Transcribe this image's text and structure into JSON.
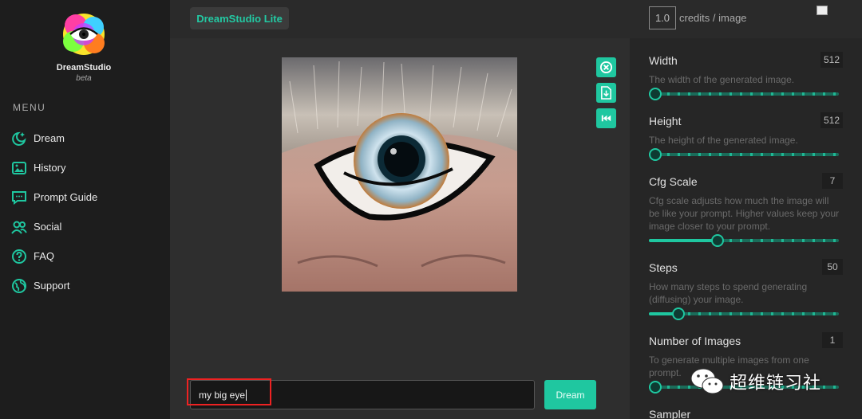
{
  "topbar": {
    "brand_label": "DreamStudio Lite",
    "credits_value": "1.0",
    "credits_label": "credits / image"
  },
  "sidebar": {
    "app_name": "DreamStudio",
    "app_subtitle": "beta",
    "menu_title": "MENU",
    "items": [
      {
        "label": "Dream",
        "icon": "sparkle-moon-icon"
      },
      {
        "label": "History",
        "icon": "gallery-icon"
      },
      {
        "label": "Prompt Guide",
        "icon": "chat-bubble-icon"
      },
      {
        "label": "Social",
        "icon": "people-icon"
      },
      {
        "label": "FAQ",
        "icon": "question-icon"
      },
      {
        "label": "Support",
        "icon": "globe-icon"
      }
    ]
  },
  "center": {
    "prompt_value": "my big eye",
    "dream_label": "Dream",
    "actions": [
      "close-icon",
      "download-icon",
      "rewind-icon"
    ]
  },
  "settings": [
    {
      "name": "Width",
      "value": "512",
      "desc": "The width of the generated image.",
      "level": 0.0
    },
    {
      "name": "Height",
      "value": "512",
      "desc": "The height of the generated image.",
      "level": 0.0
    },
    {
      "name": "Cfg Scale",
      "value": "7",
      "desc": "Cfg scale adjusts how much the image will be like your prompt. Higher values keep your image closer to your prompt.",
      "level": 0.35
    },
    {
      "name": "Steps",
      "value": "50",
      "desc": "How many steps to spend generating (diffusing) your image.",
      "level": 0.13
    },
    {
      "name": "Number of Images",
      "value": "1",
      "desc": "To generate multiple images from one prompt.",
      "level": 0.0
    },
    {
      "name": "Sampler",
      "value": "",
      "desc": "",
      "level": 0.0
    }
  ],
  "watermark": {
    "text": "超维链习社"
  },
  "colors": {
    "accent": "#1fc7a0",
    "sidebar_bg": "#1d1d1d",
    "panel_bg": "#262626",
    "highlight": "#ee2222"
  }
}
